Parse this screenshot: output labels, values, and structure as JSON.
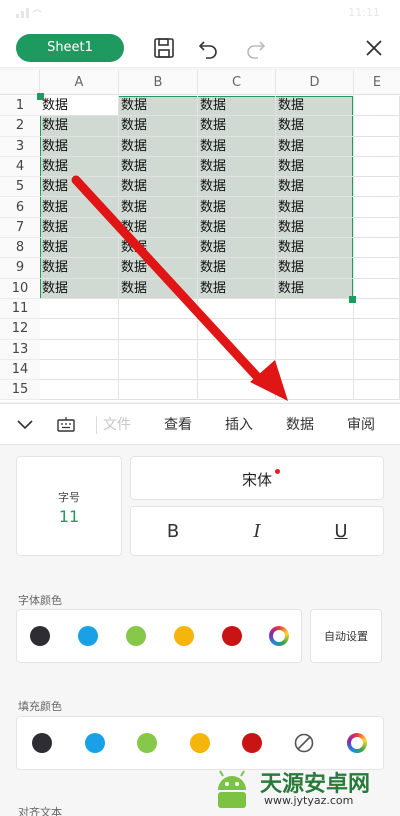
{
  "status": {
    "time": "11:11"
  },
  "toolbar": {
    "sheet_tab": "Sheet1",
    "icons": [
      "save-icon",
      "undo-icon",
      "redo-icon",
      "close-icon"
    ]
  },
  "grid": {
    "columns": [
      "A",
      "B",
      "C",
      "D",
      "E"
    ],
    "rows": [
      "1",
      "2",
      "3",
      "4",
      "5",
      "6",
      "7",
      "8",
      "9",
      "10",
      "11",
      "12",
      "13",
      "14",
      "15"
    ],
    "cell_text": "数据"
  },
  "ribbon": {
    "tabs": [
      "文件",
      "查看",
      "插入",
      "数据",
      "审阅"
    ]
  },
  "panel": {
    "font_size_label": "字号",
    "font_size_value": "11",
    "font_name": "宋体",
    "bold": "B",
    "italic": "I",
    "underline": "U",
    "font_color_title": "字体颜色",
    "font_colors": [
      "#2d2d33",
      "#1aa0e6",
      "#86c84a",
      "#f5b50a",
      "#c81414"
    ],
    "auto_set": "自动设置",
    "fill_color_title": "填充颜色",
    "fill_colors": [
      "#2d2d33",
      "#1aa0e6",
      "#86c84a",
      "#f5b50a",
      "#c81414"
    ],
    "align_title": "对齐文本",
    "accent": "#1f9a60"
  },
  "watermark": {
    "title": "天源安卓网",
    "url": "www.jytyaz.com"
  }
}
